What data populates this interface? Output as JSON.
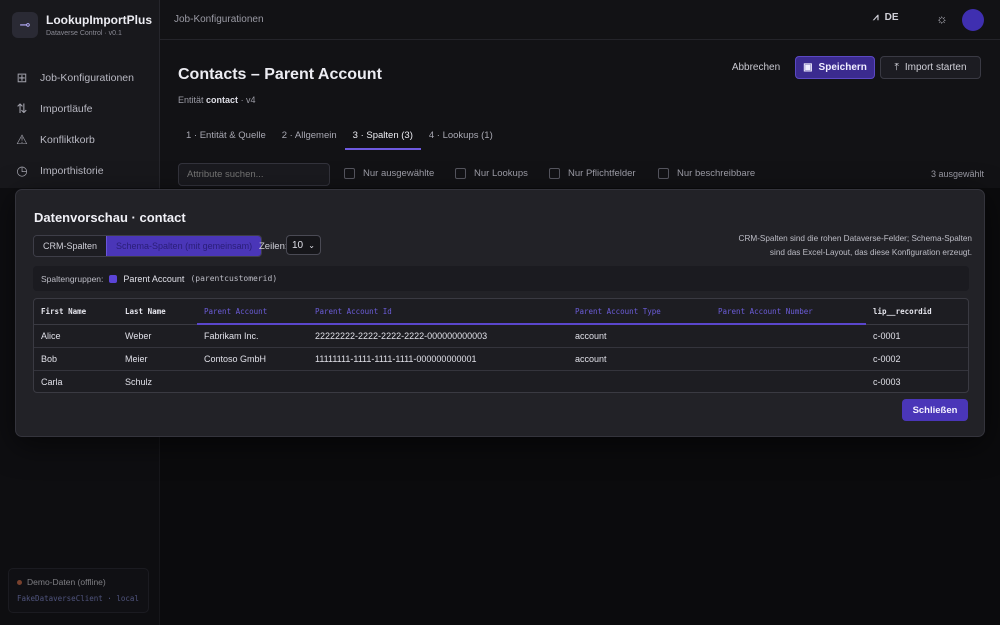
{
  "app": {
    "title": "LookupImportPlus",
    "subtitle": "Dataverse Control · v0.1"
  },
  "sidebar": {
    "items": [
      {
        "label": "Job-Konfigurationen",
        "icon": "grid-icon"
      },
      {
        "label": "Importläufe",
        "icon": "up-down-arrows-icon"
      },
      {
        "label": "Konfliktkorb",
        "icon": "warning-triangle-icon"
      },
      {
        "label": "Importhistorie",
        "icon": "history-icon"
      }
    ],
    "demo": {
      "title": "Demo-Daten (offline)",
      "client": "FakeDataverseClient · local"
    }
  },
  "topbar": {
    "breadcrumb": "Job-Konfigurationen",
    "language": "DE"
  },
  "page": {
    "title": "Contacts – Parent Account",
    "entity_label": "Entität",
    "entity": "contact",
    "version": "· v4",
    "buttons": {
      "cancel": "Abbrechen",
      "save": "Speichern",
      "import": "Import starten"
    },
    "tabs": [
      {
        "label": "1 · Entität & Quelle",
        "active": false
      },
      {
        "label": "2 · Allgemein",
        "active": false
      },
      {
        "label": "3 · Spalten (3)",
        "active": true
      },
      {
        "label": "4 · Lookups (1)",
        "active": false
      }
    ],
    "filters": {
      "search_placeholder": "Attribute suchen...",
      "checkboxes": [
        "Nur ausgewählte",
        "Nur Lookups",
        "Nur Pflichtfelder",
        "Nur beschreibbare"
      ],
      "selected_count": "3 ausgewählt"
    }
  },
  "modal": {
    "title": "Datenvorschau · contact",
    "segments": [
      {
        "label": "CRM-Spalten",
        "active": false
      },
      {
        "label": "Schema-Spalten (mit gemeinsam)",
        "active": true
      }
    ],
    "rows_label": "Zeilen:",
    "rows_value": "10",
    "note": "CRM-Spalten sind die rohen Dataverse-Felder; Schema-Spalten sind das Excel-Layout, das diese Konfiguration erzeugt.",
    "groups_label": "Spaltengruppen:",
    "group": {
      "name": "Parent Account",
      "code": "(parentcustomerid)",
      "color": "#5b44d6"
    },
    "columns": [
      "First Name",
      "Last Name",
      "Parent Account",
      "Parent Account Id",
      "Parent Account Type",
      "Parent Account Number",
      "lip__recordid"
    ],
    "rows": [
      [
        "Alice",
        "Weber",
        "Fabrikam Inc.",
        "22222222-2222-2222-2222-000000000003",
        "account",
        "",
        "c-0001"
      ],
      [
        "Bob",
        "Meier",
        "Contoso GmbH",
        "11111111-1111-1111-1111-000000000001",
        "account",
        "",
        "c-0002"
      ],
      [
        "Carla",
        "Schulz",
        "",
        "",
        "",
        "",
        "c-0003"
      ]
    ],
    "close_label": "Schließen"
  },
  "colors": {
    "accent": "#4a36b8",
    "background": "#121215"
  }
}
